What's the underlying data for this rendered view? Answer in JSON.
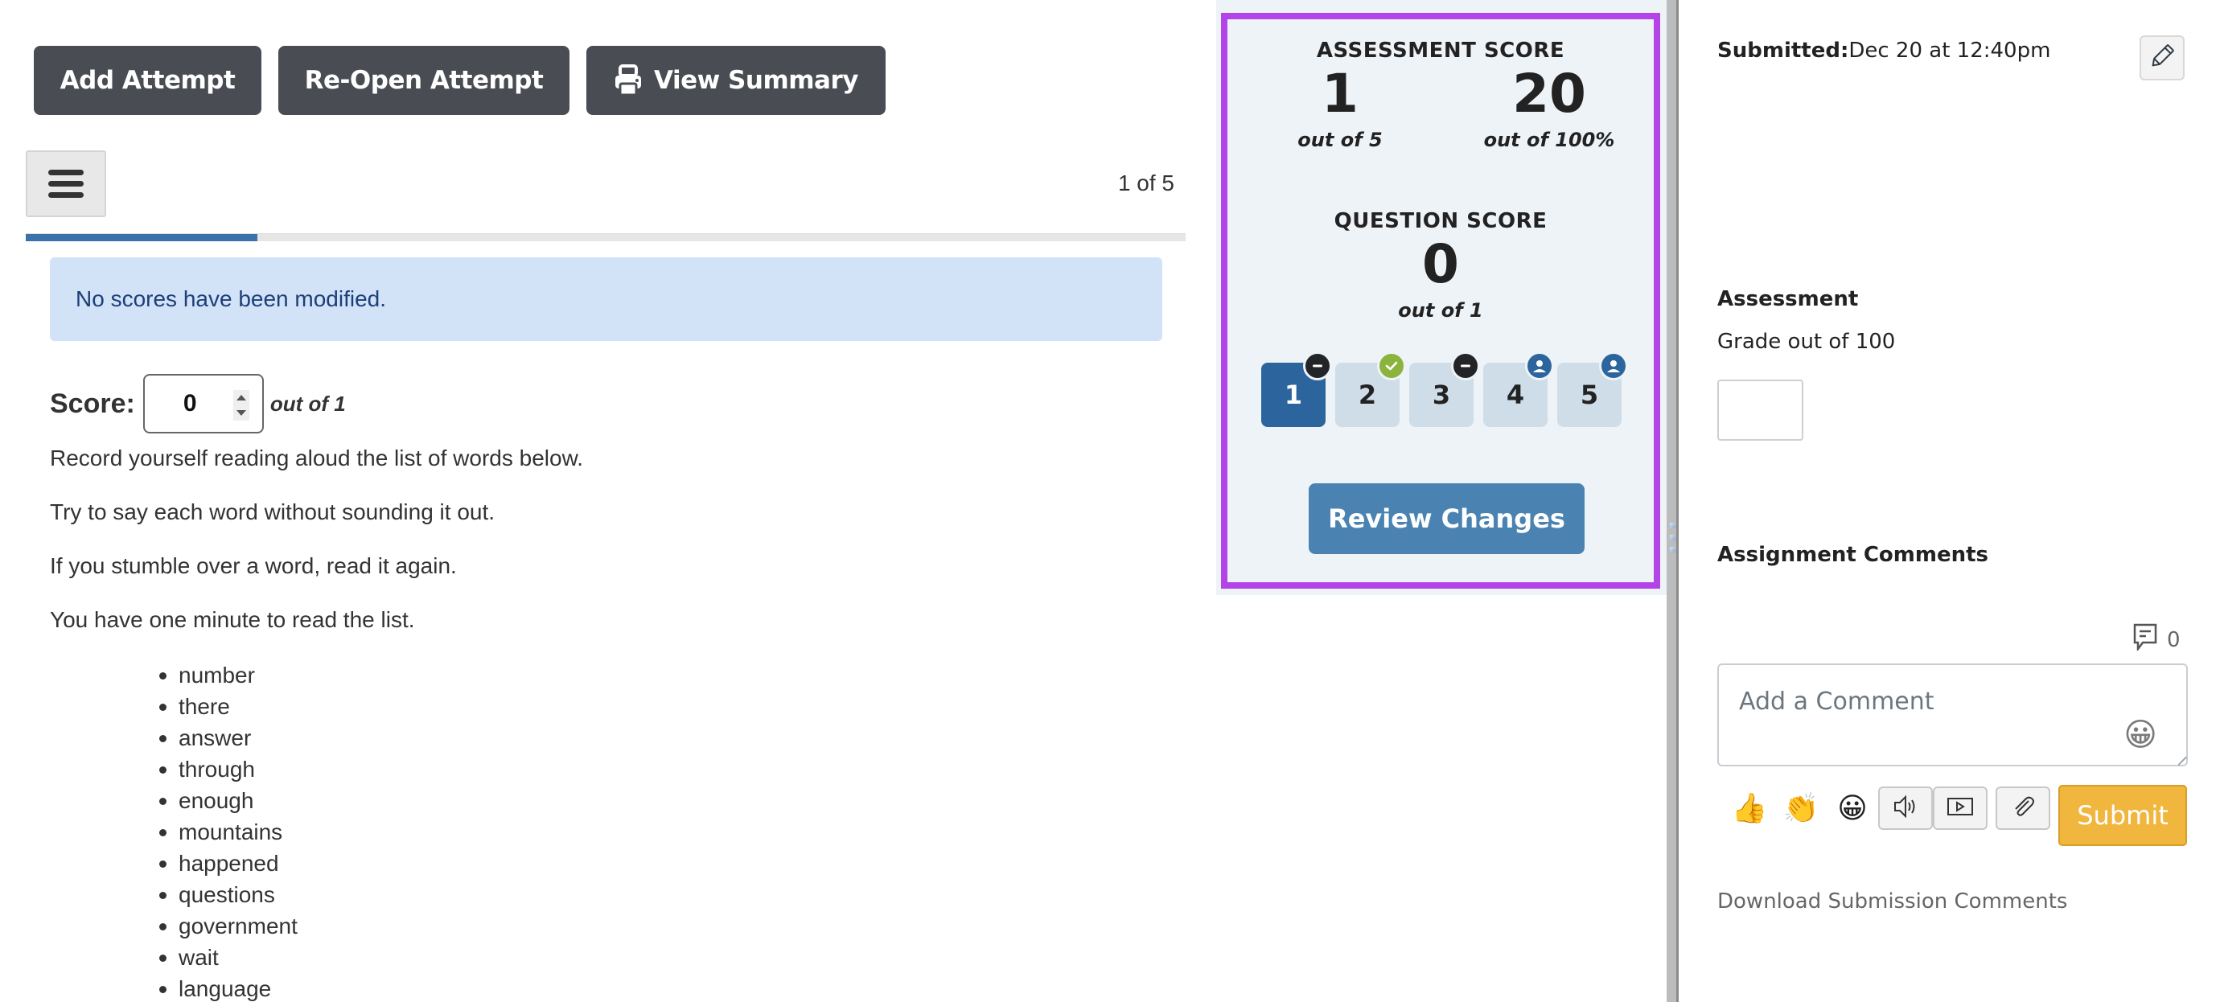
{
  "toolbar": {
    "add_attempt": "Add Attempt",
    "reopen_attempt": "Re-Open Attempt",
    "view_summary": "View Summary",
    "view_summary_icon": "printer-icon"
  },
  "navigator": {
    "menu_icon": "hamburger-icon",
    "page_count": "1 of 5",
    "progress_fraction": 0.2
  },
  "alert": {
    "message": "No scores have been modified."
  },
  "score": {
    "label": "Score:",
    "value": "0",
    "out_of": "out of 1"
  },
  "question": {
    "instructions": [
      "Record yourself reading aloud the list of words below.",
      "Try to say each word without sounding it out.",
      "If you stumble over a word, read it again.",
      "You have one minute to read the list."
    ],
    "words": [
      "number",
      "there",
      "answer",
      "through",
      "enough",
      "mountains",
      "happened",
      "questions",
      "government",
      "wait",
      "language"
    ]
  },
  "score_panel": {
    "assessment_heading": "ASSESSMENT SCORE",
    "assessment_points": "1",
    "assessment_points_out_of": "out of 5",
    "assessment_percent": "20",
    "assessment_percent_out_of": "out of 100%",
    "question_heading": "QUESTION SCORE",
    "question_points": "0",
    "question_points_out_of": "out of 1",
    "questions": [
      {
        "label": "1",
        "status": "dash",
        "status_icon": "minus-icon",
        "active": true
      },
      {
        "label": "2",
        "status": "check",
        "status_icon": "check-icon",
        "active": false
      },
      {
        "label": "3",
        "status": "dash",
        "status_icon": "minus-icon",
        "active": false
      },
      {
        "label": "4",
        "status": "user",
        "status_icon": "user-icon",
        "active": false
      },
      {
        "label": "5",
        "status": "user",
        "status_icon": "user-icon",
        "active": false
      }
    ],
    "review_button": "Review Changes",
    "highlight_color": "#b244e8"
  },
  "sidebar": {
    "submitted_label": "Submitted:",
    "submitted_value": "Dec 20 at 12:40pm",
    "edit_icon": "pencil-icon",
    "assessment_title": "Assessment",
    "grade_label": "Grade out of 100",
    "grade_value": "",
    "comments_title": "Assignment Comments",
    "comment_count": "0",
    "comment_placeholder": "Add a Comment",
    "quick_emojis": [
      "👍",
      "👏",
      "😀"
    ],
    "submit_label": "Submit",
    "download_link": "Download Submission Comments",
    "submit_color": "#f0b63e"
  }
}
